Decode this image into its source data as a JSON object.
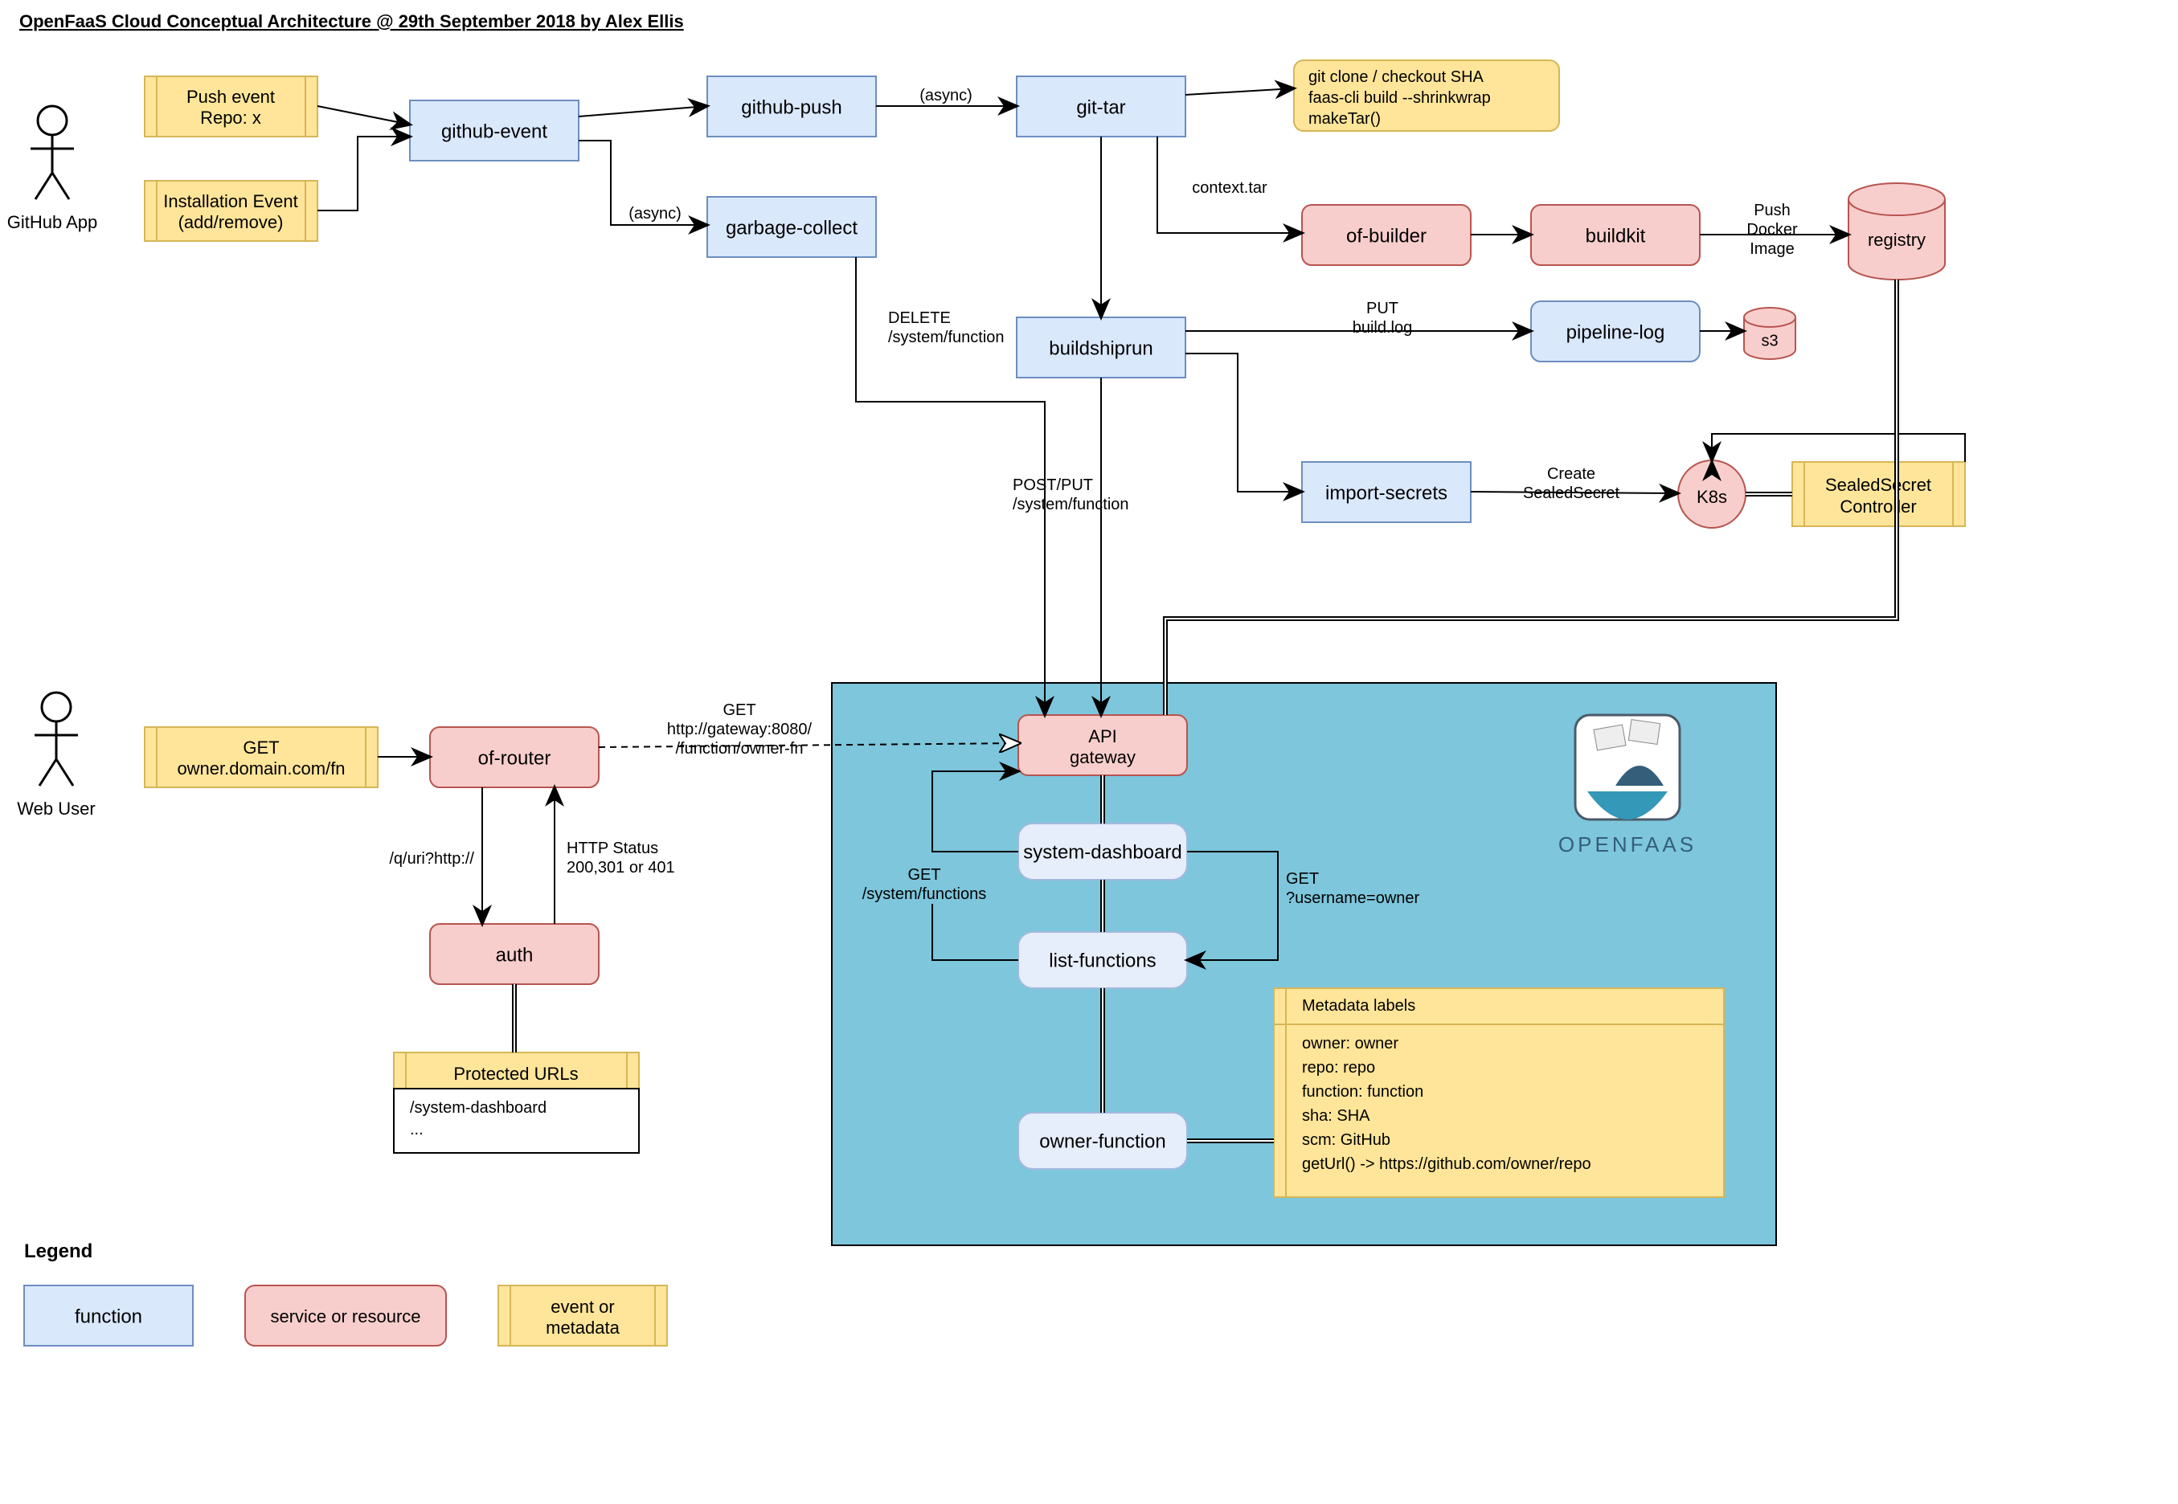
{
  "title": "OpenFaaS Cloud Conceptual Architecture @ 29th September 2018 by Alex Ellis",
  "actors": {
    "github_app": "GitHub App",
    "web_user": "Web User"
  },
  "events": {
    "push_event_l1": "Push event",
    "push_event_l2": "Repo: x",
    "install_event_l1": "Installation Event",
    "install_event_l2": "(add/remove)",
    "get_owner_l1": "GET",
    "get_owner_l2": "owner.domain.com/fn",
    "git_cmds_l1": "git clone / checkout SHA",
    "git_cmds_l2": "faas-cli build --shrinkwrap",
    "git_cmds_l3": "makeTar()",
    "protected_urls_title": "Protected URLs",
    "protected_urls_l1": "/system-dashboard",
    "protected_urls_l2": "...",
    "meta_title": "Metadata labels",
    "meta_l1": "owner: owner",
    "meta_l2": "repo: repo",
    "meta_l3": "function: function",
    "meta_l4": "sha: SHA",
    "meta_l5": "scm: GitHub",
    "meta_l6": "getUrl() -> https://github.com/owner/repo",
    "sealed_secret_l1": "SealedSecret",
    "sealed_secret_l2": "Controller"
  },
  "functions": {
    "github_event": "github-event",
    "github_push": "github-push",
    "git_tar": "git-tar",
    "garbage_collect": "garbage-collect",
    "buildshiprun": "buildshiprun",
    "import_secrets": "import-secrets",
    "pipeline_log": "pipeline-log",
    "system_dashboard": "system-dashboard",
    "list_functions": "list-functions",
    "owner_function": "owner-function"
  },
  "services": {
    "of_builder": "of-builder",
    "buildkit": "buildkit",
    "registry": "registry",
    "s3": "s3",
    "k8s": "K8s",
    "of_router": "of-router",
    "auth": "auth",
    "api_gateway_l1": "API",
    "api_gateway_l2": "gateway"
  },
  "edges": {
    "async1": "(async)",
    "async2": "(async)",
    "context_tar": "context.tar",
    "push_docker_l1": "Push",
    "push_docker_l2": "Docker",
    "push_docker_l3": "Image",
    "put_buildlog_l1": "PUT",
    "put_buildlog_l2": "build.log",
    "create_sealed_l1": "Create",
    "create_sealed_l2": "SealedSecret",
    "delete_fn_l1": "DELETE",
    "delete_fn_l2": "/system/function",
    "postput_fn_l1": "POST/PUT",
    "postput_fn_l2": "/system/function",
    "get_gateway_l1": "GET",
    "get_gateway_l2": "http://gateway:8080/",
    "get_gateway_l3": "/function/owner-fn",
    "q_uri": "/q/uri?http://",
    "http_status_l1": "HTTP Status",
    "http_status_l2": "200,301 or 401",
    "get_sys_fns_l1": "GET",
    "get_sys_fns_l2": "/system/functions",
    "get_username_l1": "GET",
    "get_username_l2": "?username=owner"
  },
  "legend": {
    "title": "Legend",
    "function": "function",
    "service": "service or resource",
    "event_l1": "event or",
    "event_l2": "metadata"
  },
  "logo": "OPENFAAS"
}
